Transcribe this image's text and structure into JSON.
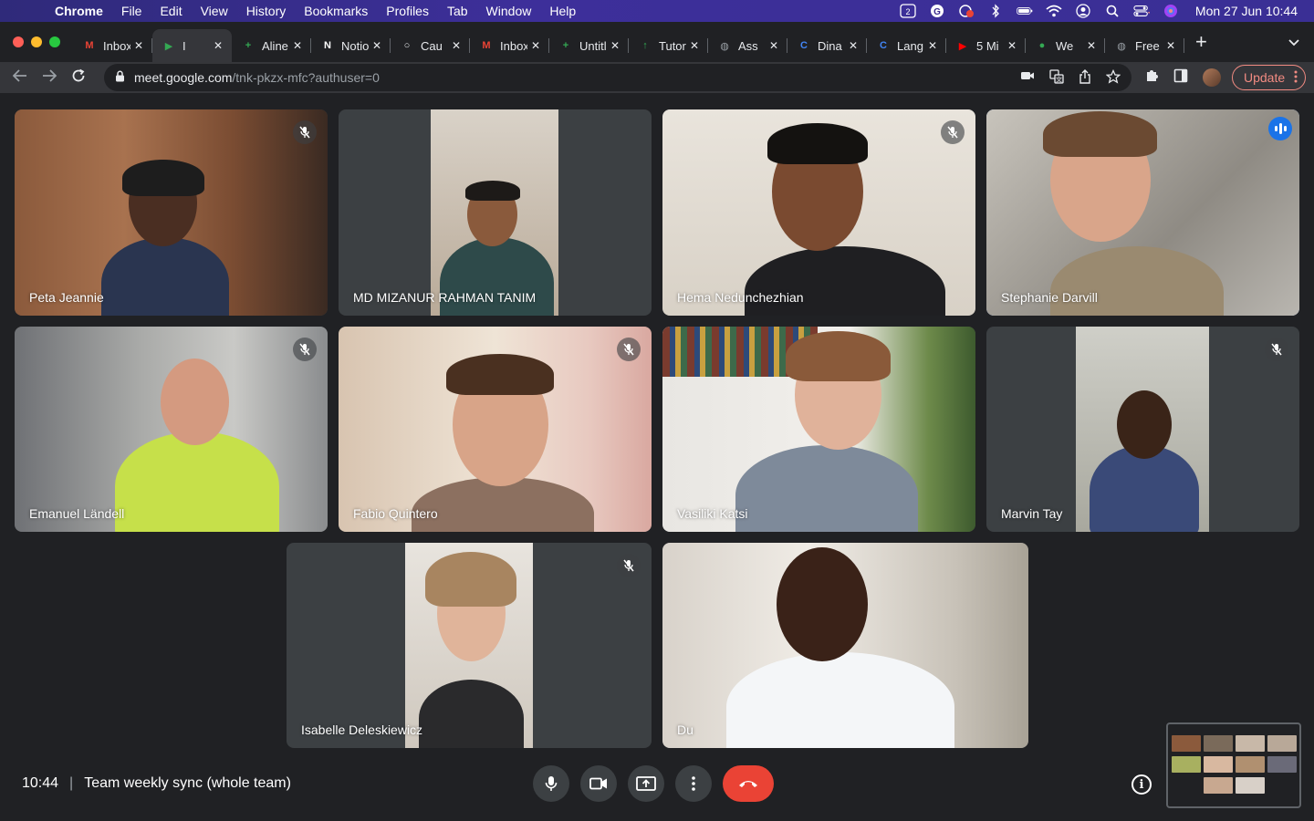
{
  "menubar": {
    "app": "Chrome",
    "items": [
      "File",
      "Edit",
      "View",
      "History",
      "Bookmarks",
      "Profiles",
      "Tab",
      "Window",
      "Help"
    ],
    "clock": "Mon 27 Jun  10:44"
  },
  "tabs": [
    {
      "label": "Inbox",
      "icon": "gmail-icon",
      "color": "#ea4335",
      "glyph": "M"
    },
    {
      "label": "I",
      "icon": "meet-icon",
      "color": "#34a853",
      "glyph": "▶",
      "active": true
    },
    {
      "label": "Aline",
      "icon": "sheets-icon",
      "color": "#34a853",
      "glyph": "+"
    },
    {
      "label": "Notion",
      "icon": "notion-icon",
      "color": "#ffffff",
      "glyph": "N"
    },
    {
      "label": "Cau",
      "icon": "circle-icon",
      "color": "#e8eaed",
      "glyph": "○"
    },
    {
      "label": "Inbox",
      "icon": "gmail-icon",
      "color": "#ea4335",
      "glyph": "M"
    },
    {
      "label": "Untitled",
      "icon": "sheets-icon",
      "color": "#34a853",
      "glyph": "+"
    },
    {
      "label": "Tutor",
      "icon": "green-doc-icon",
      "color": "#34a853",
      "glyph": "↑"
    },
    {
      "label": "Ass",
      "icon": "globe-icon",
      "color": "#9aa0a6",
      "glyph": "◍"
    },
    {
      "label": "Dina",
      "icon": "c-logo-icon",
      "color": "#4285f4",
      "glyph": "C"
    },
    {
      "label": "Lang",
      "icon": "c-logo-icon",
      "color": "#4285f4",
      "glyph": "C"
    },
    {
      "label": "5 Mi",
      "icon": "youtube-icon",
      "color": "#ff0000",
      "glyph": "▶"
    },
    {
      "label": "We",
      "icon": "green-circle-icon",
      "color": "#34a853",
      "glyph": "●"
    },
    {
      "label": "Free",
      "icon": "globe-icon",
      "color": "#9aa0a6",
      "glyph": "◍"
    }
  ],
  "address": {
    "host": "meet.google.com",
    "path": "/tnk-pkzx-mfc?authuser=0"
  },
  "update_label": "Update",
  "participants": [
    {
      "name": "Peta Jeannie",
      "muted": true
    },
    {
      "name": "MD MIZANUR RAHMAN TANIM",
      "muted": false
    },
    {
      "name": "Hema Nedunchezhian",
      "muted": true
    },
    {
      "name": "Stephanie Darvill",
      "muted": false,
      "speaking": true
    },
    {
      "name": "Emanuel Ländell",
      "muted": true
    },
    {
      "name": "Fabio Quintero",
      "muted": true
    },
    {
      "name": "Vasiliki Katsi",
      "muted": false
    },
    {
      "name": "Marvin Tay",
      "muted": true
    },
    {
      "name": "Isabelle Deleskiewicz",
      "muted": true
    },
    {
      "name": "Du",
      "muted": false
    }
  ],
  "meeting": {
    "time": "10:44",
    "title": "Team weekly sync (whole team)"
  },
  "colors": {
    "accent": "#8ab4f8",
    "hangup": "#ea4335",
    "speaking_badge": "#1a73e8"
  }
}
